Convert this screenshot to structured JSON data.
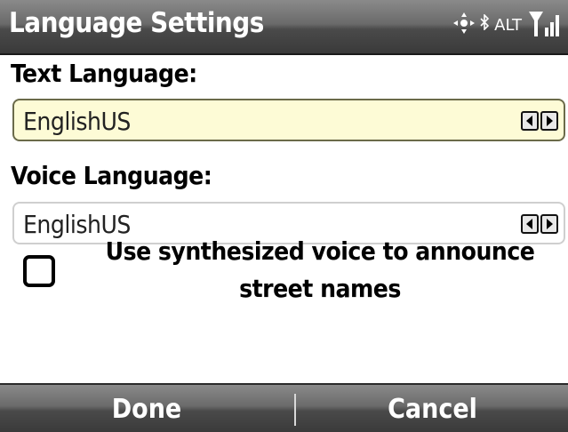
{
  "titlebar": {
    "title": "Language Settings",
    "status_icons": [
      "gps-crosshair-icon",
      "bluetooth-icon",
      "signal-strength-icon"
    ],
    "alt_label": "ALT"
  },
  "text_language": {
    "label": "Text Language:",
    "value": "EnglishUS"
  },
  "voice_language": {
    "label": "Voice Language:",
    "value": "EnglishUS"
  },
  "synth_voice": {
    "checked": false,
    "label": "Use synthesized voice to announce street names"
  },
  "softkeys": {
    "left_label": "Done",
    "right_label": "Cancel"
  },
  "colors": {
    "bar_gradient_top": "#8a8a8a",
    "bar_gradient_bottom": "#3a3a3a",
    "focused_field_bg": "#fdfbd6"
  }
}
